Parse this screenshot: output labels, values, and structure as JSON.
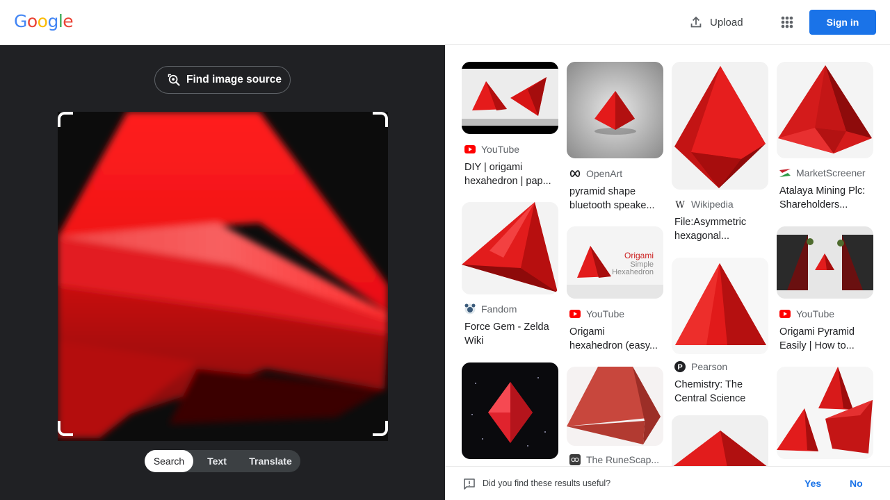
{
  "header": {
    "logo_letters": [
      "G",
      "o",
      "o",
      "g",
      "l",
      "e"
    ],
    "upload_label": "Upload",
    "signin_label": "Sign in"
  },
  "lens": {
    "find_source_label": "Find image source",
    "modes": [
      "Search",
      "Text",
      "Translate"
    ],
    "active_mode": "Search"
  },
  "results": [
    {
      "source": "YouTube",
      "title_lines": [
        "DIY | origami",
        "hexahedron | pap..."
      ],
      "favicon": "youtube-icon"
    },
    {
      "source": "Fandom",
      "title_lines": [
        "Force Gem - Zelda",
        "Wiki"
      ],
      "favicon": "fandom-icon"
    },
    {
      "source": "OpenArt",
      "title_lines": [
        "pyramid shape",
        "bluetooth speake..."
      ],
      "favicon": "openart-icon"
    },
    {
      "source": "YouTube",
      "title_lines": [
        "Origami",
        "hexahedron (easy..."
      ],
      "favicon": "youtube-icon",
      "thumb_text": [
        "Origami",
        "Simple",
        "Hexahedron"
      ]
    },
    {
      "source": "The RuneScap...",
      "title_lines": [],
      "favicon": "runescape-icon"
    },
    {
      "source": "Wikipedia",
      "title_lines": [
        "File:Asymmetric",
        "hexagonal..."
      ],
      "favicon": "wikipedia-icon"
    },
    {
      "source": "Pearson",
      "title_lines": [
        "Chemistry: The",
        "Central Science"
      ],
      "favicon": "pearson-icon"
    },
    {
      "source": "MarketScreener",
      "title_lines": [
        "Atalaya Mining Plc:",
        "Shareholders..."
      ],
      "favicon": "marketscreener-icon"
    },
    {
      "source": "YouTube",
      "title_lines": [
        "Origami Pyramid",
        "Easily | How to..."
      ],
      "favicon": "youtube-icon"
    }
  ],
  "feedback": {
    "question": "Did you find these results useful?",
    "yes_label": "Yes",
    "no_label": "No"
  },
  "colors": {
    "brand_blue": "#4285F4",
    "brand_red": "#EA4335",
    "brand_yellow": "#FBBC05",
    "brand_green": "#34A853",
    "signin_bg": "#1a73e8",
    "left_panel_bg": "#202124",
    "accent_red": "#e01010"
  }
}
